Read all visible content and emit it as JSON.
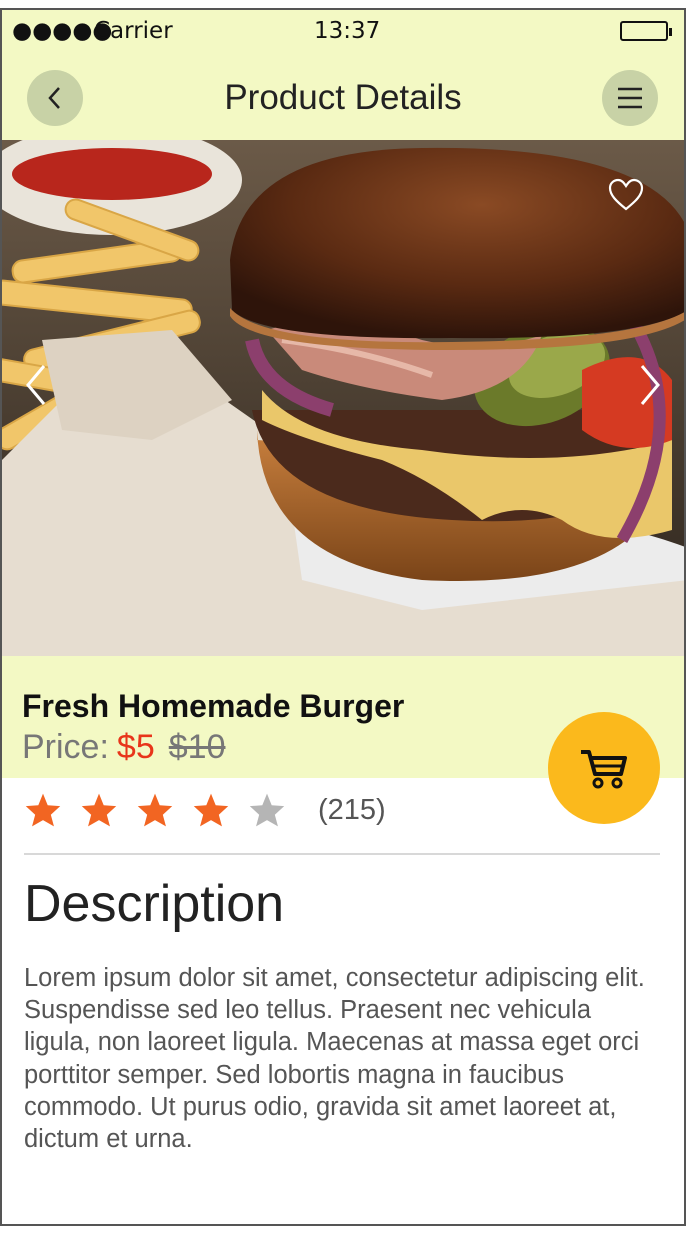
{
  "status_bar": {
    "signal": "●●●●●",
    "carrier": "Carrier",
    "time": "13:37",
    "battery_icon": "battery-full-icon"
  },
  "nav": {
    "title": "Product Details",
    "back_icon": "chevron-left-icon",
    "menu_icon": "hamburger-menu-icon"
  },
  "hero": {
    "image": "burger-photo",
    "prev_icon": "chevron-left-icon",
    "next_icon": "chevron-right-icon",
    "favorite_icon": "heart-outline-icon"
  },
  "product": {
    "name": "Fresh Homemade Burger",
    "price_label": "Price:",
    "price_current": "$5",
    "price_original": "$10",
    "cart_icon": "shopping-cart-icon"
  },
  "rating": {
    "stars": 4,
    "max_stars": 5,
    "count": "(215)",
    "filled_color": "#f26522",
    "empty_color": "#b5b5b5"
  },
  "description": {
    "title": "Description",
    "body": "Lorem ipsum dolor sit amet, consectetur adipiscing elit. Suspendisse sed leo tellus. Praesent nec vehicula ligula, non laoreet ligula. Maecenas at massa eget orci porttitor semper. Sed lobortis magna in faucibus commodo. Ut purus odio, gravida sit amet laoreet at, dictum et urna."
  },
  "colors": {
    "header_bg": "#f3f9c4",
    "accent_price": "#e8351a",
    "cart_button": "#fbb91c",
    "nav_button": "#c8d2a6"
  }
}
